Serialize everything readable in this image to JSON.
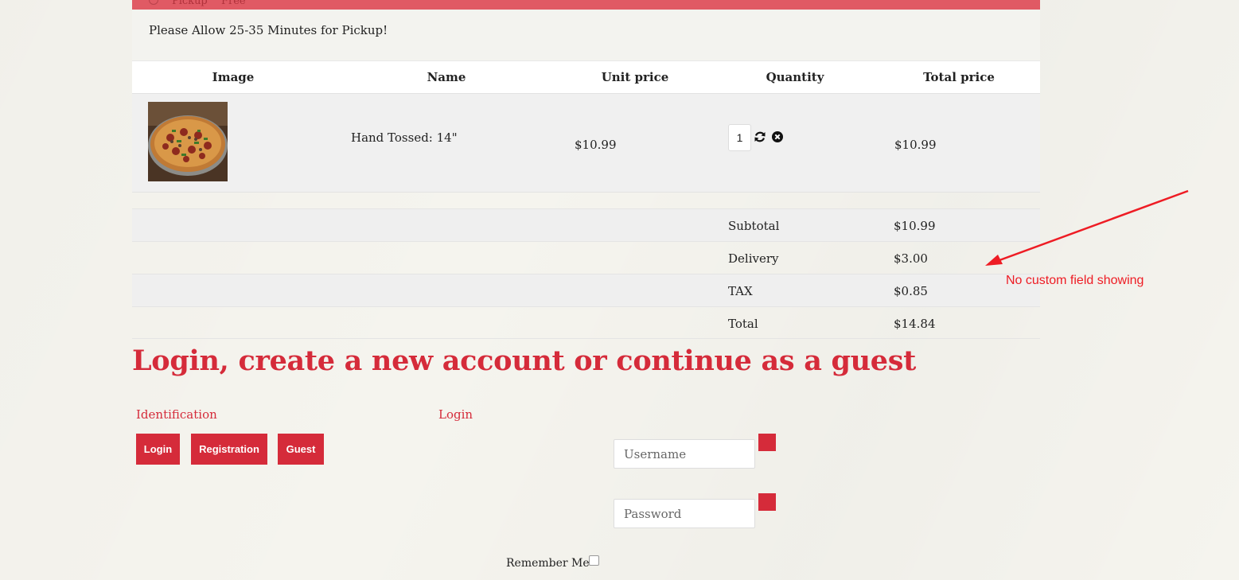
{
  "shipping": {
    "name": "Pickup",
    "price": "Free"
  },
  "notice": "Please Allow 25-35 Minutes for Pickup!",
  "cart": {
    "headers": [
      "Image",
      "Name",
      "Unit price",
      "Quantity",
      "Total price"
    ],
    "item": {
      "name": "Hand Tossed: 14\"",
      "unit_price": "$10.99",
      "quantity": "1",
      "total_price": "$10.99"
    },
    "summary": [
      {
        "label": "Subtotal",
        "value": "$10.99"
      },
      {
        "label": "Delivery",
        "value": "$3.00"
      },
      {
        "label": "TAX",
        "value": "$0.85"
      },
      {
        "label": "Total",
        "value": "$14.84"
      }
    ]
  },
  "annotation": {
    "text": "No custom field showing",
    "color": "#ee1c24"
  },
  "login": {
    "heading": "Login, create a new account or continue as a guest",
    "identification_label": "Identification",
    "login_label": "Login",
    "buttons": {
      "login": "Login",
      "registration": "Registration",
      "guest": "Guest"
    },
    "username_placeholder": "Username",
    "password_placeholder": "Password",
    "remember_me": "Remember Me"
  },
  "colors": {
    "accent": "#d52b3a",
    "banner": "#e05a64"
  },
  "icons": {
    "refresh": "refresh-icon",
    "remove": "remove-icon"
  }
}
